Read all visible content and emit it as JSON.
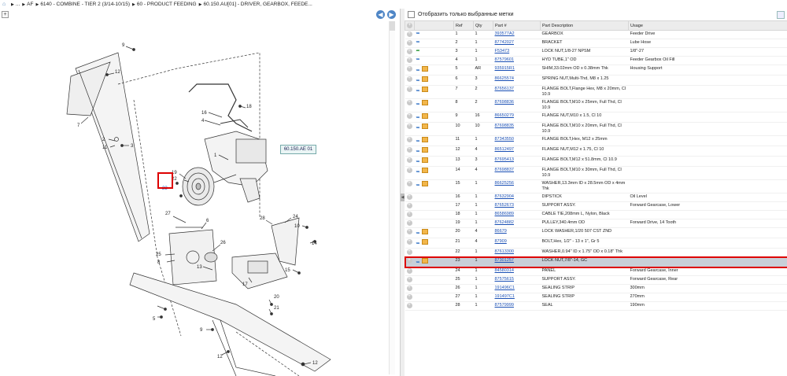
{
  "breadcrumb": {
    "items": [
      "...",
      "AF",
      "6140 - COMBINE - TIER 2 (3/14-10/15)",
      "60 - PRODUCT FEEDING",
      "60.150.AU[01] - DRIVER, GEARBOX, FEEDE..."
    ]
  },
  "diagram": {
    "callout": "60.150.AE 01",
    "labels": [
      "9",
      "12",
      "7",
      "2",
      "11",
      "3",
      "16",
      "4",
      "18",
      "1",
      "19",
      "22",
      "23",
      "27",
      "6",
      "26",
      "25",
      "8",
      "17",
      "13",
      "28",
      "24",
      "10",
      "14",
      "15",
      "5",
      "20",
      "21",
      "9",
      "12",
      "12"
    ]
  },
  "right": {
    "filter_label": "Отобразить только выбранные метки",
    "columns": [
      "Ref",
      "Qty",
      "Part #",
      "Part Description",
      "Usage"
    ],
    "rows": [
      {
        "ref": "1",
        "qty": "1",
        "part": "393577A2",
        "desc": "GEARBOX",
        "usage": "Feeder Drive",
        "icons": [
          "arrow",
          "none"
        ]
      },
      {
        "ref": "2",
        "qty": "1",
        "part": "87742027",
        "desc": "BRACKET",
        "usage": "Lube Hose",
        "icons": [
          "arrow",
          "none"
        ]
      },
      {
        "ref": "3",
        "qty": "1",
        "part": "F53473",
        "desc": "LOCK NUT,1/8-27 NPSM",
        "usage": "1/8\"-27",
        "icons": [
          "green",
          "none"
        ]
      },
      {
        "ref": "4",
        "qty": "1",
        "part": "87579601",
        "desc": "HYD TUBE,1\" OD",
        "usage": "Feeder Gearbox Oil Fill",
        "icons": [
          "arrow",
          "none"
        ]
      },
      {
        "ref": "5",
        "qty": "AR",
        "part": "935915R1",
        "desc": "SHIM,33.02mm OD x 0.38mm Thk",
        "usage": "Housing Support",
        "icons": [
          "arrow",
          "box"
        ]
      },
      {
        "ref": "6",
        "qty": "3",
        "part": "86625574",
        "desc": "SPRING NUT,Multi-Thd, M8 x 1.25",
        "usage": "",
        "icons": [
          "arrow",
          "box"
        ]
      },
      {
        "ref": "7",
        "qty": "2",
        "part": "87656137",
        "desc": "FLANGE BOLT,Flange Hex, M8 x 20mm, Cl 10.9",
        "usage": "",
        "icons": [
          "arrow",
          "box"
        ]
      },
      {
        "ref": "8",
        "qty": "2",
        "part": "87698836",
        "desc": "FLANGE BOLT,M10 x 25mm, Full Thd, Cl 10.9",
        "usage": "",
        "icons": [
          "arrow",
          "box"
        ]
      },
      {
        "ref": "9",
        "qty": "16",
        "part": "86650279",
        "desc": "FLANGE NUT,M10 x 1.5, Cl 10",
        "usage": "",
        "icons": [
          "arrow",
          "box"
        ]
      },
      {
        "ref": "10",
        "qty": "10",
        "part": "87698835",
        "desc": "FLANGE BOLT,M10 x 20mm, Full Thd, Cl 10.9",
        "usage": "",
        "icons": [
          "arrow",
          "box"
        ]
      },
      {
        "ref": "11",
        "qty": "1",
        "part": "87343550",
        "desc": "FLANGE BOLT,Hex, M12 x 25mm",
        "usage": "",
        "icons": [
          "arrow",
          "box"
        ]
      },
      {
        "ref": "12",
        "qty": "4",
        "part": "86512497",
        "desc": "FLANGE NUT,M12 x 1.75, Cl 10",
        "usage": "",
        "icons": [
          "arrow",
          "box"
        ]
      },
      {
        "ref": "13",
        "qty": "3",
        "part": "87695413",
        "desc": "FLANGE BOLT,M12 x 51.8mm, Cl 10.9",
        "usage": "",
        "icons": [
          "arrow",
          "box"
        ]
      },
      {
        "ref": "14",
        "qty": "4",
        "part": "87698837",
        "desc": "FLANGE BOLT,M10 x 30mm, Full Thd, Cl 10.9",
        "usage": "",
        "icons": [
          "arrow",
          "box"
        ]
      },
      {
        "ref": "15",
        "qty": "1",
        "part": "86625256",
        "desc": "WASHER,13.3mm ID x 28.5mm OD x 4mm Thk",
        "usage": "",
        "icons": [
          "arrow",
          "box"
        ]
      },
      {
        "ref": "16",
        "qty": "1",
        "part": "87632904",
        "desc": "DIPSTICK",
        "usage": "Oil Level",
        "icons": [
          "none",
          "none"
        ]
      },
      {
        "ref": "17",
        "qty": "1",
        "part": "87652673",
        "desc": "SUPPORT ASSY.",
        "usage": "Forward Gearcase, Lower",
        "icons": [
          "none",
          "none"
        ]
      },
      {
        "ref": "18",
        "qty": "1",
        "part": "86586989",
        "desc": "CABLE TIE,208mm L, Nylon, Black",
        "usage": "",
        "icons": [
          "none",
          "none"
        ]
      },
      {
        "ref": "19",
        "qty": "1",
        "part": "87624882",
        "desc": "PULLEY,340.4mm OD",
        "usage": "Forward Drive, 14 Tooth",
        "icons": [
          "none",
          "none"
        ]
      },
      {
        "ref": "20",
        "qty": "4",
        "part": "86679",
        "desc": "LOCK WASHER,1/20 507 CST ZND",
        "usage": "",
        "icons": [
          "arrow",
          "box"
        ]
      },
      {
        "ref": "21",
        "qty": "4",
        "part": "87909",
        "desc": "BOLT,Hex, 1/2\" - 13 x 1\", Gr 5",
        "usage": "",
        "icons": [
          "arrow",
          "box"
        ]
      },
      {
        "ref": "22",
        "qty": "1",
        "part": "87613300",
        "desc": "WASHER,0.94\" ID x 1.75\" OD x 0.18\" Thk",
        "usage": "",
        "icons": [
          "none",
          "none"
        ]
      },
      {
        "ref": "23",
        "qty": "1",
        "part": "87301257",
        "desc": "LOCK NUT,7/8\"-14, GC",
        "usage": "",
        "icons": [
          "arrow",
          "box"
        ],
        "selected": true
      },
      {
        "ref": "24",
        "qty": "1",
        "part": "84580314",
        "desc": "PANEL",
        "usage": "Forward Gearcase, Inner",
        "icons": [
          "none",
          "none"
        ]
      },
      {
        "ref": "25",
        "qty": "1",
        "part": "87575615",
        "desc": "SUPPORT ASSY.",
        "usage": "Forward Gearcase, Rear",
        "icons": [
          "none",
          "none"
        ]
      },
      {
        "ref": "26",
        "qty": "1",
        "part": "191496C1",
        "desc": "SEALING STRIP",
        "usage": "300mm",
        "icons": [
          "none",
          "none"
        ]
      },
      {
        "ref": "27",
        "qty": "1",
        "part": "191497C1",
        "desc": "SEALING STRIP",
        "usage": "270mm",
        "icons": [
          "none",
          "none"
        ]
      },
      {
        "ref": "28",
        "qty": "1",
        "part": "87579999",
        "desc": "SEAL",
        "usage": "190mm",
        "icons": [
          "none",
          "none"
        ]
      }
    ]
  }
}
